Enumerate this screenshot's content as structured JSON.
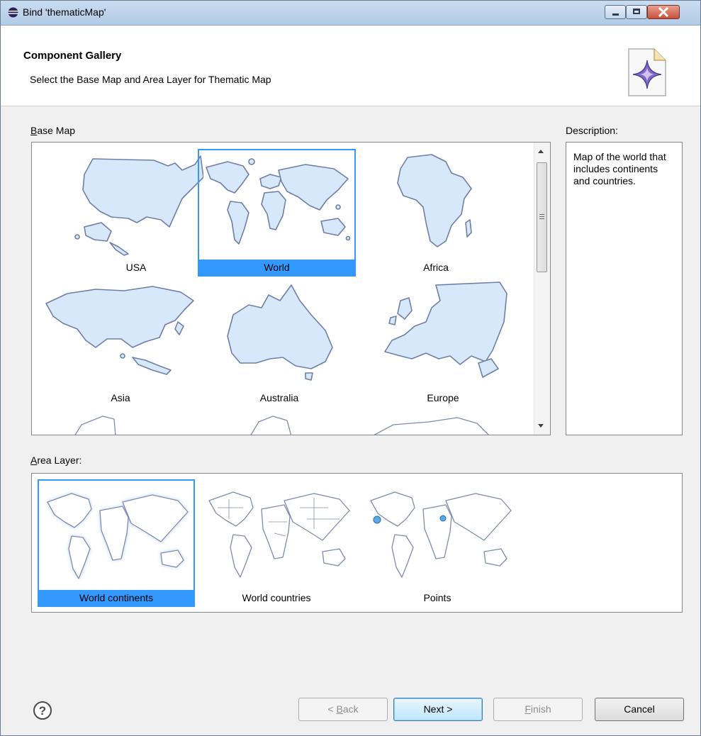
{
  "window": {
    "title": "Bind 'thematicMap'",
    "title_icon": "eclipse-icon",
    "controls": [
      "minimize-icon",
      "maximize-icon",
      "close-icon"
    ]
  },
  "banner": {
    "title": "Component Gallery",
    "subtitle": "Select the Base Map and Area Layer for Thematic Map",
    "icon": "wizard-sparkle-icon"
  },
  "base_map": {
    "label_prefix": "",
    "label_mnemonic": "B",
    "label_rest": "ase Map",
    "items": [
      {
        "label": "USA",
        "selected": false
      },
      {
        "label": "World",
        "selected": true
      },
      {
        "label": "Africa",
        "selected": false
      },
      {
        "label": "Asia",
        "selected": false
      },
      {
        "label": "Australia",
        "selected": false
      },
      {
        "label": "Europe",
        "selected": false
      }
    ]
  },
  "description": {
    "label": "Description:",
    "text": "Map of the world that includes continents and countries."
  },
  "area_layer": {
    "label_mnemonic": "A",
    "label_rest": "rea Layer:",
    "items": [
      {
        "label": "World continents",
        "selected": true
      },
      {
        "label": "World countries",
        "selected": false
      },
      {
        "label": "Points",
        "selected": false
      }
    ]
  },
  "footer": {
    "help_icon": "help-icon",
    "back": {
      "prefix": "< ",
      "mnemonic": "B",
      "rest": "ack",
      "enabled": false
    },
    "next": {
      "label": "Next >",
      "enabled": true
    },
    "finish": {
      "mnemonic": "F",
      "rest": "inish",
      "enabled": false
    },
    "cancel": {
      "label": "Cancel",
      "enabled": true
    }
  },
  "colors": {
    "selection": "#3399ff",
    "map_fill": "#d8e8fb",
    "dialog_bg": "#f0f0f0"
  }
}
